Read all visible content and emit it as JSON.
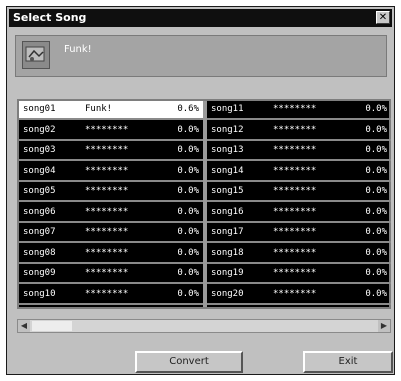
{
  "window": {
    "title": "Select Song"
  },
  "header": {
    "title": "Funk!"
  },
  "songs": {
    "left": [
      {
        "name": "song01",
        "title": "Funk!",
        "pct": "0.6%"
      },
      {
        "name": "song02",
        "title": "********",
        "pct": "0.0%"
      },
      {
        "name": "song03",
        "title": "********",
        "pct": "0.0%"
      },
      {
        "name": "song04",
        "title": "********",
        "pct": "0.0%"
      },
      {
        "name": "song05",
        "title": "********",
        "pct": "0.0%"
      },
      {
        "name": "song06",
        "title": "********",
        "pct": "0.0%"
      },
      {
        "name": "song07",
        "title": "********",
        "pct": "0.0%"
      },
      {
        "name": "song08",
        "title": "********",
        "pct": "0.0%"
      },
      {
        "name": "song09",
        "title": "********",
        "pct": "0.0%"
      },
      {
        "name": "song10",
        "title": "********",
        "pct": "0.0%"
      }
    ],
    "right": [
      {
        "name": "song11",
        "title": "********",
        "pct": "0.0%"
      },
      {
        "name": "song12",
        "title": "********",
        "pct": "0.0%"
      },
      {
        "name": "song13",
        "title": "********",
        "pct": "0.0%"
      },
      {
        "name": "song14",
        "title": "********",
        "pct": "0.0%"
      },
      {
        "name": "song15",
        "title": "********",
        "pct": "0.0%"
      },
      {
        "name": "song16",
        "title": "********",
        "pct": "0.0%"
      },
      {
        "name": "song17",
        "title": "********",
        "pct": "0.0%"
      },
      {
        "name": "song18",
        "title": "********",
        "pct": "0.0%"
      },
      {
        "name": "song19",
        "title": "********",
        "pct": "0.0%"
      },
      {
        "name": "song20",
        "title": "********",
        "pct": "0.0%"
      }
    ],
    "selected": "song01"
  },
  "buttons": {
    "convert": "Convert",
    "exit": "Exit"
  },
  "icons": {
    "close": "close-icon",
    "song": "song-icon"
  },
  "colors": {
    "title_bar": "#0f0f0f",
    "list_bg": "#000000",
    "selected_row": "#ffffff",
    "window_bg": "#c0c0c0"
  }
}
